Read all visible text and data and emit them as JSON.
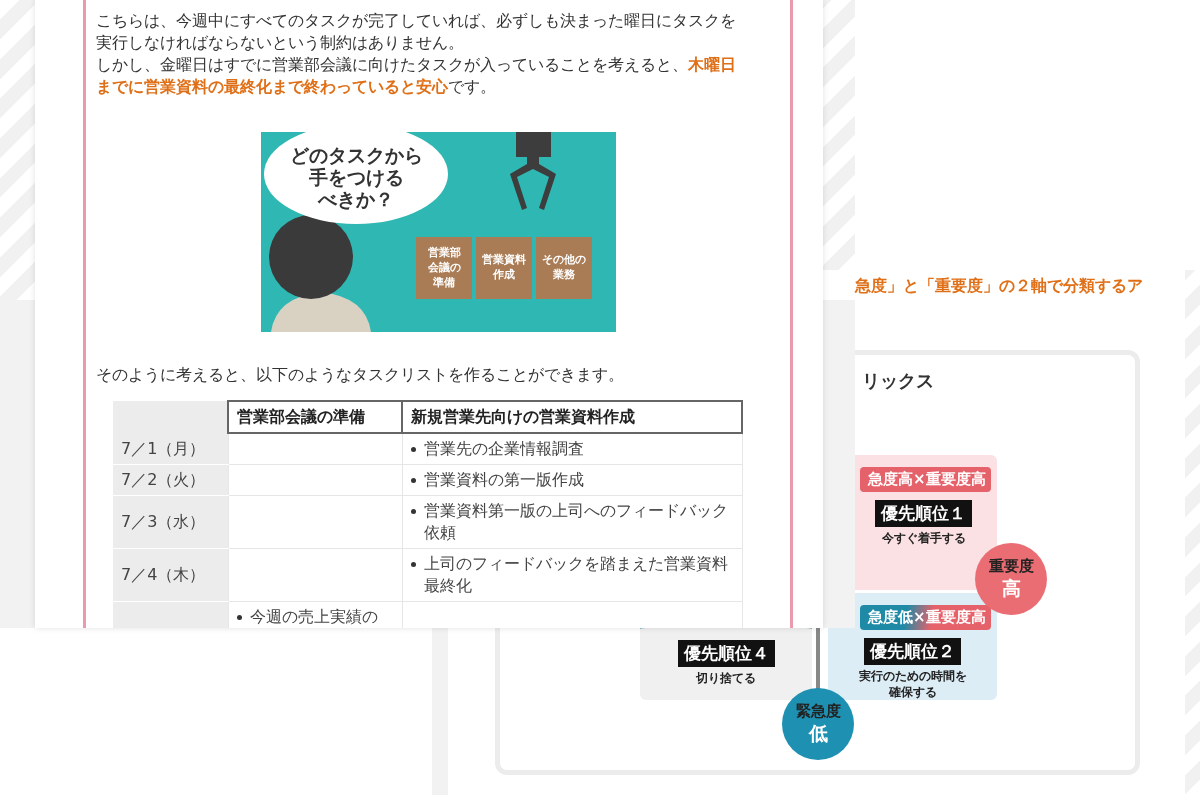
{
  "article": {
    "paragraphs": [
      "こちらは、今週中にすべてのタスクが完了していれば、必ずしも決まった曜日にタスクを実行しなければならないという制約はありません。",
      "しかし、金曜日はすでに営業部会議に向けたタスクが入っていることを考えると、**木曜日までに営業資料の最終化まで終わっていると安心**です。"
    ],
    "illustration": {
      "speech": [
        "どのタスクから",
        "手をつける",
        "べきか？"
      ],
      "boxes": [
        [
          "営業部",
          "会議の",
          "準備"
        ],
        [
          "営業資料",
          "作成"
        ],
        [
          "その他の",
          "業務"
        ]
      ]
    },
    "lead": "そのように考えると、以下のようなタスクリストを作ることができます。",
    "table": {
      "columns": [
        "営業部会議の準備",
        "新規営業先向けの営業資料作成"
      ],
      "rows": [
        {
          "date": "7／1（月）",
          "tasks_1": [],
          "tasks_2": [
            "営業先の企業情報調査"
          ]
        },
        {
          "date": "7／2（火）",
          "tasks_1": [],
          "tasks_2": [
            "営業資料の第一版作成"
          ]
        },
        {
          "date": "7／3（水）",
          "tasks_1": [],
          "tasks_2": [
            "営業資料第一版の上司へのフィードバック依頼"
          ]
        },
        {
          "date": "7／4（木）",
          "tasks_1": [],
          "tasks_2": [
            "上司のフィードバックを踏まえた営業資料最終化"
          ]
        },
        {
          "tasks_1": [
            "今週の売上実績の"
          ],
          "tasks_2": []
        }
      ]
    }
  },
  "back_article": {
    "heading": "急度」と「重要度」の２軸で分類するア",
    "matrix": {
      "title": "リックス",
      "quadrants": [
        {
          "kind": "do",
          "label": "急度高×重要度高",
          "priority": "優先順位１",
          "action": "今すぐ着手する"
        },
        {
          "kind": "drop",
          "priority": "優先順位４",
          "action": "切り捨てる"
        },
        {
          "kind": "schedule",
          "label": "急度低×重要度高",
          "priority": "優先順位２",
          "action": "実行のための時間を確保する"
        }
      ],
      "axes": [
        {
          "kind": "importance",
          "name": "重要度",
          "level_text": "高"
        },
        {
          "kind": "urgency",
          "name": "緊急度",
          "level_text": "低"
        }
      ]
    }
  }
}
